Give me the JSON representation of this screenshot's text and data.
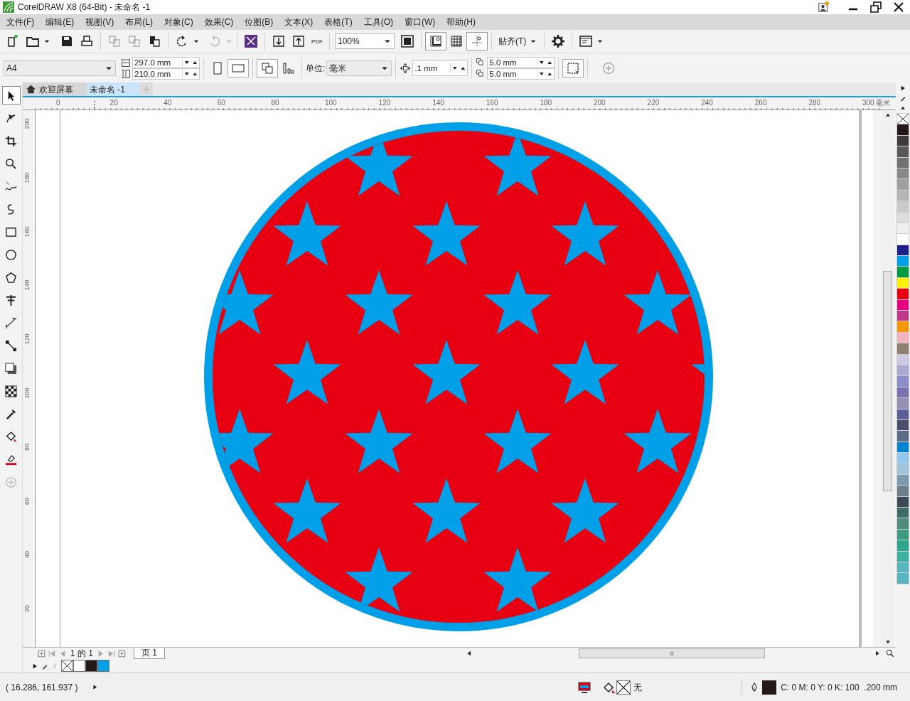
{
  "window": {
    "title": "CorelDRAW X8 (64-Bit) - 未命名 -1"
  },
  "menu": [
    "文件(F)",
    "编辑(E)",
    "视图(V)",
    "布局(L)",
    "对象(C)",
    "效果(C)",
    "位图(B)",
    "文本(X)",
    "表格(T)",
    "工具(O)",
    "窗口(W)",
    "帮助(H)"
  ],
  "toolbar": {
    "pdf_label": "PDF",
    "zoom": "100%",
    "snap": "贴齐(T)"
  },
  "property_bar": {
    "page_size": "A4",
    "width": "297.0 mm",
    "height": "210.0 mm",
    "units_label": "单位:",
    "units": "毫米",
    "nudge": ".1 mm",
    "dup_x": "5.0 mm",
    "dup_y": "5.0 mm"
  },
  "toolbox": [
    {
      "selected": true
    },
    {
      "selected": false
    },
    {
      "selected": false
    },
    {
      "selected": false
    },
    {
      "selected": false
    },
    {
      "selected": false
    },
    {
      "selected": false
    },
    {
      "selected": false
    },
    {
      "selected": false
    },
    {
      "selected": false
    },
    {
      "selected": false
    },
    {
      "selected": false
    },
    {
      "selected": false
    },
    {
      "selected": false
    },
    {
      "selected": false
    },
    {
      "selected": false
    },
    {
      "selected": false
    },
    {
      "selected": false
    }
  ],
  "doc_tabs": [
    {
      "label": "欢迎屏幕",
      "selected": false
    },
    {
      "label": "未命名 -1",
      "selected": true
    }
  ],
  "ruler": {
    "h_labels": [
      "0",
      "20",
      "40",
      "60",
      "80",
      "100",
      "120",
      "140",
      "160",
      "180",
      "200",
      "220",
      "240",
      "260",
      "280",
      "300"
    ],
    "unit": "毫米",
    "v_labels": [
      "200",
      "180",
      "160",
      "140",
      "120",
      "100",
      "80",
      "60",
      "40",
      "20"
    ]
  },
  "page_nav": {
    "pages": "1 的 1",
    "tab": "页 1"
  },
  "doc_palette": [
    {
      "kind": "none"
    },
    {
      "color": "#ffffff"
    },
    {
      "color": "#231815"
    },
    {
      "color": "#00a0e9"
    }
  ],
  "palette": [
    {
      "kind": "none"
    },
    {
      "color": "#231815"
    },
    {
      "color": "#3e3a39"
    },
    {
      "color": "#595757"
    },
    {
      "color": "#727171"
    },
    {
      "color": "#898989"
    },
    {
      "color": "#9fa0a0"
    },
    {
      "color": "#b5b5b6"
    },
    {
      "color": "#c9caca"
    },
    {
      "color": "#dcdddd"
    },
    {
      "color": "#efefef"
    },
    {
      "color": "#ffffff"
    },
    {
      "color": "#1d2088"
    },
    {
      "color": "#00a0e9"
    },
    {
      "color": "#009944"
    },
    {
      "color": "#fff100"
    },
    {
      "color": "#e60012"
    },
    {
      "color": "#e4007f"
    },
    {
      "color": "#c0378a"
    },
    {
      "color": "#f39800"
    },
    {
      "color": "#f4b3c2"
    },
    {
      "color": "#8f7f6f"
    },
    {
      "color": "#c9c9e4"
    },
    {
      "color": "#aaa9d3"
    },
    {
      "color": "#8b8ec8"
    },
    {
      "color": "#7b72b3"
    },
    {
      "color": "#9491b5"
    },
    {
      "color": "#5b5f97"
    },
    {
      "color": "#4b4e6d"
    },
    {
      "color": "#5a6b85"
    },
    {
      "color": "#0086d1"
    },
    {
      "color": "#90c7ea"
    },
    {
      "color": "#a0c4d9"
    },
    {
      "color": "#7d9bb0"
    },
    {
      "color": "#6e7e8a"
    },
    {
      "color": "#3b4a56"
    },
    {
      "color": "#3d6b6a"
    },
    {
      "color": "#508b7f"
    },
    {
      "color": "#3c9d7e"
    },
    {
      "color": "#2fa58d"
    },
    {
      "color": "#3bb0a0"
    },
    {
      "color": "#56b6be"
    },
    {
      "color": "#5ab2c3"
    }
  ],
  "status_bar": {
    "coords": "( 16.286, 161.937 )",
    "fill": "无",
    "outline": "C: 0 M: 0 Y: 0 K: 100  .200 mm"
  }
}
